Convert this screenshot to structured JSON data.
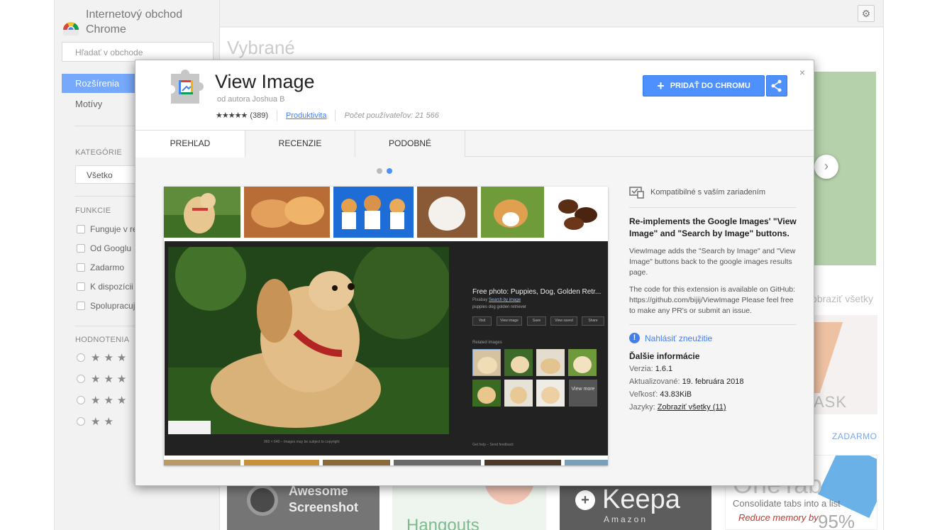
{
  "store": {
    "title": "Internetový obchod Chrome",
    "search_placeholder": "Hľadať v obchode",
    "nav": [
      {
        "label": "Rozšírenia",
        "active": true
      },
      {
        "label": "Motívy",
        "active": false
      }
    ],
    "categories_heading": "KATEGÓRIE",
    "category_selected": "Všetko",
    "features_heading": "FUNKCIE",
    "features": [
      "Funguje v re",
      "Od Googlu",
      "Zadarmo",
      "K dispozícii",
      "Spolupracuj"
    ],
    "ratings_heading": "HODNOTENIA",
    "ratings": [
      "★★★",
      "★★★",
      "★★★",
      "★★"
    ],
    "featured_heading": "Vybrané",
    "show_all": "obraziť všetky",
    "ask_text": "ASK",
    "free_label": "ZADARMO",
    "bottom_tiles": {
      "awesome": "Awesome\nScreenshot",
      "hangouts": "Hangouts",
      "keepa": "Keepa",
      "keepa_sub": "Amazon",
      "onetab_logo": "OneTab",
      "onetab_consolidate": "Consolidate tabs into a list",
      "onetab_reduce": "Reduce memory by",
      "onetab_percent": "95%"
    }
  },
  "dialog": {
    "close": "×",
    "title": "View Image",
    "author": "od autora Joshua B",
    "stars": "★★★★★",
    "rating_count": "(389)",
    "category": "Produktivita",
    "users": "Počet používateľov: 21 566",
    "add_button": "PRIDAŤ DO CHROMU",
    "tabs": [
      "PREHĽAD",
      "RECENZIE",
      "PODOBNÉ"
    ],
    "screenshot": {
      "title": "Free photo: Puppies, Dog, Golden Retr...",
      "source_prefix": "Pixabay",
      "source_link": "Search by image",
      "tags": "puppies dog golden retriever",
      "buttons": [
        "Visit",
        "View image",
        "Save",
        "View saved",
        "Share"
      ],
      "related": "Related images",
      "view_more": "View more",
      "footer": "960 × 640 – Images may be subject to copyright",
      "footer2": "Get help – Send feedback"
    },
    "compat": "Kompatibilné s vaším zariadením",
    "summary": "Re-implements the Google Images' \"View Image\" and \"Search by Image\" buttons.",
    "desc1": "ViewImage adds the \"Search by Image\" and \"View Image\" buttons back to the google images results page.",
    "desc2": "The code for this extension is available on GitHub: https://github.com/bijij/ViewImage Please feel free to make any PR's or submit an issue.",
    "report": "Nahlásiť zneužitie",
    "more_heading": "Ďalšie informácie",
    "version_label": "Verzia:",
    "version": "1.6.1",
    "updated_label": "Aktualizované:",
    "updated": "19. februára 2018",
    "size_label": "Veľkosť:",
    "size": "43.83KiB",
    "lang_label": "Jazyky:",
    "lang_link": "Zobraziť všetky (11)"
  },
  "colors": {
    "accent": "#4d90fe",
    "link": "#427fed"
  }
}
